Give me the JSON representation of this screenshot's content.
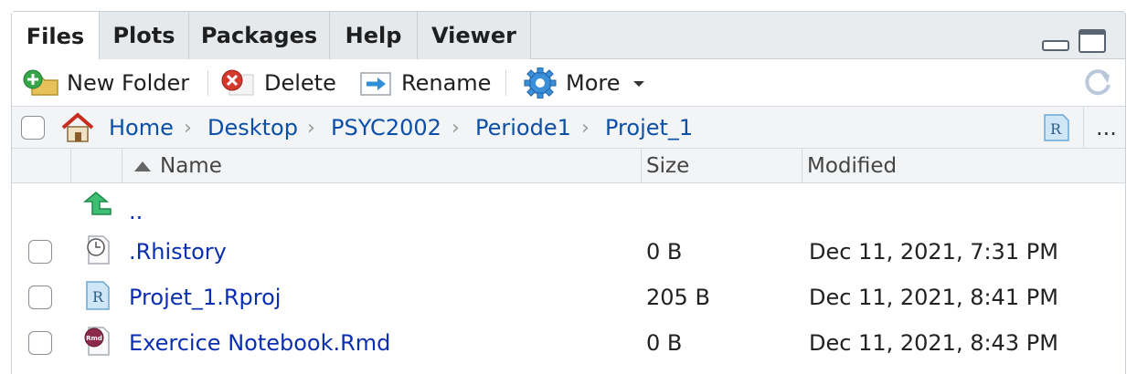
{
  "tabs": [
    {
      "label": "Files",
      "active": true
    },
    {
      "label": "Plots",
      "active": false
    },
    {
      "label": "Packages",
      "active": false
    },
    {
      "label": "Help",
      "active": false
    },
    {
      "label": "Viewer",
      "active": false
    }
  ],
  "toolbar": {
    "new_folder": "New Folder",
    "delete": "Delete",
    "rename": "Rename",
    "more": "More"
  },
  "breadcrumb": [
    "Home",
    "Desktop",
    "PSYC2002",
    "Periode1",
    "Projet_1"
  ],
  "breadcrumb_more": "...",
  "columns": {
    "name": "Name",
    "size": "Size",
    "modified": "Modified"
  },
  "parent_dir": "..",
  "files": [
    {
      "name": ".Rhistory",
      "size": "0 B",
      "modified": "Dec 11, 2021, 7:31 PM",
      "icon": "history-file-icon"
    },
    {
      "name": "Projet_1.Rproj",
      "size": "205 B",
      "modified": "Dec 11, 2021, 8:41 PM",
      "icon": "rproj-file-icon"
    },
    {
      "name": "Exercice Notebook.Rmd",
      "size": "0 B",
      "modified": "Dec 11, 2021, 8:43 PM",
      "icon": "rmd-file-icon"
    }
  ],
  "colors": {
    "link": "#0b4fa8",
    "file_link": "#0b2fb0",
    "border": "#c9cfd6"
  }
}
